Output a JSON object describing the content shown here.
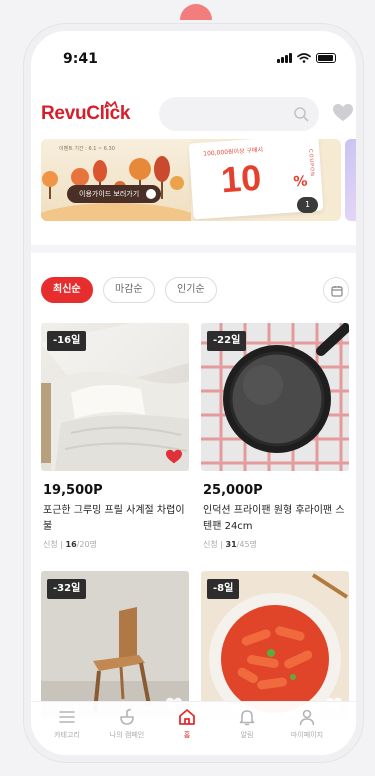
{
  "status": {
    "time": "9:41"
  },
  "header": {
    "logo": "RevuClick"
  },
  "banner": {
    "period": "이벤트 기간 : 6.1 ~ 6.30",
    "cta": "이용가이드 보러가기",
    "coupon_sub": "100,000원이상 구매시",
    "coupon_value": "10",
    "coupon_unit": "%",
    "coupon_code": "COUPON",
    "pager": "1"
  },
  "sort": {
    "options": [
      "최신순",
      "마감순",
      "인기순"
    ],
    "selected": "최신순"
  },
  "products": [
    {
      "dday": "-16일",
      "price": "19,500P",
      "title": "포근한 그루밍 프릴 사계절 차렵이불",
      "applicants_label": "신청 |",
      "applicants_count": "16",
      "applicants_total": "/20명",
      "favorited": true
    },
    {
      "dday": "-22일",
      "price": "25,000P",
      "title": "인덕션 프라이팬 원형 후라이팬 스텐팬 24cm",
      "applicants_label": "신청 |",
      "applicants_count": "31",
      "applicants_total": "/45명",
      "favorited": false
    },
    {
      "dday": "-32일",
      "favorited": false
    },
    {
      "dday": "-8일",
      "favorited": false
    }
  ],
  "tabbar": {
    "items": [
      {
        "label": "카테고리",
        "icon": "menu-icon"
      },
      {
        "label": "나의 캠페인",
        "icon": "campaign-icon"
      },
      {
        "label": "홈",
        "icon": "home-icon"
      },
      {
        "label": "알림",
        "icon": "bell-icon"
      },
      {
        "label": "마이페이지",
        "icon": "person-icon"
      }
    ],
    "active": "홈"
  },
  "colors": {
    "brand": "#d61f2b",
    "accent": "#e62e2e"
  }
}
